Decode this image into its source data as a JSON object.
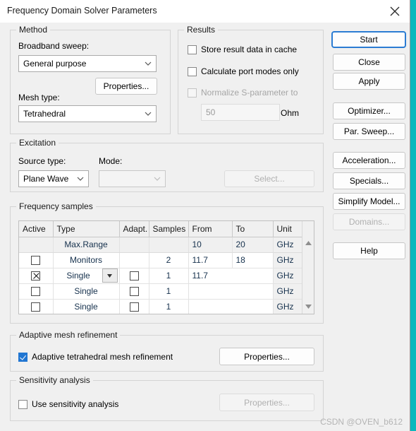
{
  "window": {
    "title": "Frequency Domain Solver Parameters",
    "close_icon": "close-icon"
  },
  "method": {
    "legend": "Method",
    "broadband_label": "Broadband sweep:",
    "broadband_value": "General purpose",
    "properties_label": "Properties...",
    "mesh_label": "Mesh type:",
    "mesh_value": "Tetrahedral"
  },
  "results": {
    "legend": "Results",
    "store_cache_label": "Store result data in cache",
    "store_cache_checked": false,
    "port_modes_label": "Calculate port modes only",
    "port_modes_checked": false,
    "normalize_label": "Normalize S-parameter to",
    "normalize_checked": false,
    "normalize_disabled": true,
    "impedance_value": "50",
    "impedance_unit": "Ohm"
  },
  "excitation": {
    "legend": "Excitation",
    "source_type_label": "Source type:",
    "source_type_value": "Plane Wave",
    "mode_label": "Mode:",
    "mode_value": "",
    "select_label": "Select..."
  },
  "frequency_samples": {
    "legend": "Frequency samples",
    "columns": [
      "Active",
      "Type",
      "Adapt.",
      "Samples",
      "From",
      "To",
      "Unit"
    ],
    "rows": [
      {
        "kind": "maxrange",
        "active": null,
        "type": "Max.Range",
        "adapt": null,
        "samples": "",
        "from": "10",
        "to": "20",
        "unit": "GHz"
      },
      {
        "kind": "normal",
        "active": false,
        "type": "Monitors",
        "adapt": null,
        "samples": "2",
        "from": "11.7",
        "to": "18",
        "unit": "GHz"
      },
      {
        "kind": "selected",
        "active": true,
        "type": "Single",
        "adapt": false,
        "samples": "1",
        "from": "11.7",
        "to": "",
        "unit": "GHz",
        "merged_range": true,
        "has_dropdown": true
      },
      {
        "kind": "normal",
        "active": false,
        "type": "Single",
        "adapt": false,
        "samples": "1",
        "from": "",
        "to": "",
        "unit": "GHz",
        "merged_range": true
      },
      {
        "kind": "normal",
        "active": false,
        "type": "Single",
        "adapt": false,
        "samples": "1",
        "from": "",
        "to": "",
        "unit": "GHz",
        "merged_range": true
      }
    ],
    "scroll_up_icon": "triangle-up-icon",
    "scroll_down_icon": "triangle-down-icon"
  },
  "adaptive_mesh": {
    "legend": "Adaptive mesh refinement",
    "checkbox_label": "Adaptive tetrahedral mesh refinement",
    "checkbox_checked": true,
    "properties_label": "Properties..."
  },
  "sensitivity": {
    "legend": "Sensitivity analysis",
    "checkbox_label": "Use sensitivity analysis",
    "checkbox_checked": false,
    "properties_label": "Properties...",
    "properties_disabled": true
  },
  "buttons": {
    "start": "Start",
    "close": "Close",
    "apply": "Apply",
    "optimizer": "Optimizer...",
    "par_sweep": "Par. Sweep...",
    "acceleration": "Acceleration...",
    "specials": "Specials...",
    "simplify_model": "Simplify Model...",
    "domains": "Domains...",
    "help": "Help"
  },
  "watermark": "CSDN @OVEN_b612",
  "colors": {
    "accent": "#2176d2",
    "default_button_border": "#2b7cd3",
    "dialog_bg": "#f0f0f0",
    "teal_backdrop": "#0cb8bd"
  }
}
